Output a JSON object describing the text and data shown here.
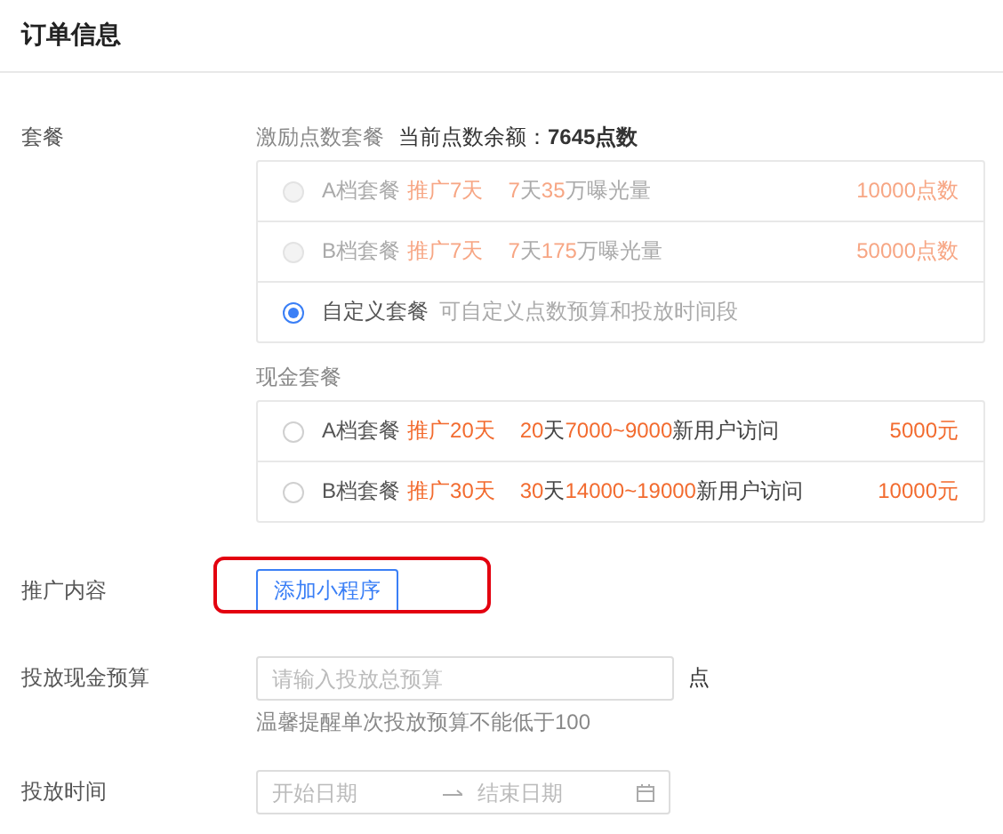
{
  "header": {
    "title": "订单信息"
  },
  "package": {
    "label": "套餐",
    "points_group": {
      "title": "激励点数套餐",
      "balance_label": "当前点数余额：",
      "balance_value": "7645点数",
      "options": [
        {
          "kind": "plan",
          "name": "A档套餐",
          "promo": "推广7天",
          "description": [
            {
              "text": "7",
              "highlight": true
            },
            {
              "text": "天",
              "highlight": false
            },
            {
              "text": "35",
              "highlight": true
            },
            {
              "text": "万曝光量",
              "highlight": false
            }
          ],
          "price": "10000点数",
          "disabled": true,
          "selected": false
        },
        {
          "kind": "plan",
          "name": "B档套餐",
          "promo": "推广7天",
          "description": [
            {
              "text": "7",
              "highlight": true
            },
            {
              "text": "天",
              "highlight": false
            },
            {
              "text": "175",
              "highlight": true
            },
            {
              "text": "万曝光量",
              "highlight": false
            }
          ],
          "price": "50000点数",
          "disabled": true,
          "selected": false
        },
        {
          "kind": "custom",
          "name": "自定义套餐",
          "note": "可自定义点数预算和投放时间段",
          "disabled": false,
          "selected": true
        }
      ]
    },
    "cash_group": {
      "title": "现金套餐",
      "options": [
        {
          "kind": "plan",
          "name": "A档套餐",
          "promo": "推广20天",
          "description": [
            {
              "text": "20",
              "highlight": true
            },
            {
              "text": "天",
              "highlight": false
            },
            {
              "text": "7000~9000",
              "highlight": true
            },
            {
              "text": "新用户访问",
              "highlight": false
            }
          ],
          "price": "5000元",
          "disabled": false,
          "selected": false
        },
        {
          "kind": "plan",
          "name": "B档套餐",
          "promo": "推广30天",
          "description": [
            {
              "text": "30",
              "highlight": true
            },
            {
              "text": "天",
              "highlight": false
            },
            {
              "text": "14000~19000",
              "highlight": true
            },
            {
              "text": "新用户访问",
              "highlight": false
            }
          ],
          "price": "10000元",
          "disabled": false,
          "selected": false
        }
      ]
    }
  },
  "promo_content": {
    "label": "推广内容",
    "button": "添加小程序",
    "highlighted": true
  },
  "budget": {
    "label": "投放现金预算",
    "placeholder": "请输入投放总预算",
    "unit": "点",
    "hint": "温馨提醒单次投放预算不能低于100"
  },
  "schedule": {
    "label": "投放时间",
    "start_placeholder": "开始日期",
    "end_placeholder": "结束日期"
  }
}
